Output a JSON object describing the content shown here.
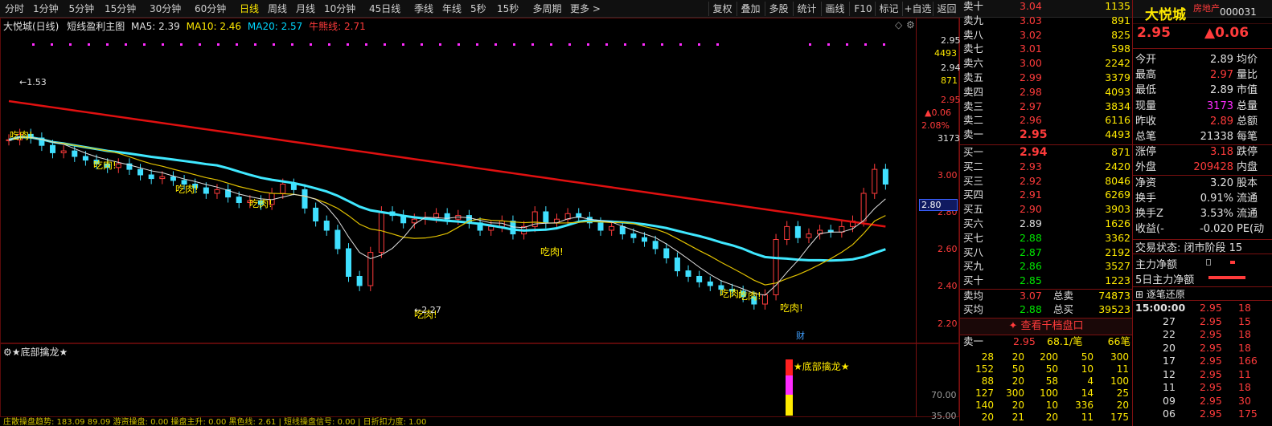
{
  "toolbar": {
    "periods": [
      "分时",
      "1分钟",
      "5分钟",
      "15分钟",
      "30分钟",
      "60分钟",
      "日线",
      "周线",
      "月线",
      "10分钟",
      "45日线",
      "季线",
      "年线",
      "5秒",
      "15秒",
      "多周期",
      "更多 >"
    ],
    "active": "日线",
    "right_buttons": [
      "复权",
      "叠加",
      "多股",
      "统计",
      "画线",
      "F10",
      "标记",
      "+自选",
      "返回"
    ]
  },
  "chart": {
    "title": "大悦城(日线)",
    "indicator": "短线盈利主图",
    "ma5": "MA5: 2.39",
    "ma10": "MA10: 2.46",
    "ma20": "MA20: 2.57",
    "niu": "牛熊线: 2.71",
    "high_label": "1.53",
    "low_label": "2.27",
    "eat": "吃肉!",
    "cai": "财",
    "y_ticks": [
      "3.00",
      "2.80",
      "2.60",
      "2.40",
      "2.20"
    ],
    "right_info": {
      "p1": "2.95",
      "v1": "4493",
      "p2": "2.94",
      "v2": "871",
      "p3": "2.95",
      "chg": "▲0.06",
      "pct": "2.08%",
      "vol": "3173"
    },
    "cur_price": "2.80"
  },
  "sub": {
    "title": "★底部擒龙★",
    "label": "★底部擒龙★",
    "ticks": [
      "70.00",
      "35.00"
    ]
  },
  "bottom_strip": "庄散操盘趋势: 183.09  89.09  游资操盘: 0.00  操盘主升: 0.00  黑色线: 2.61  | 短线操盘信号: 0.00  | 日折扣力度: 1.00",
  "orderbook": {
    "sells": [
      [
        "卖十",
        "3.04",
        "1135"
      ],
      [
        "卖九",
        "3.03",
        "891"
      ],
      [
        "卖八",
        "3.02",
        "825"
      ],
      [
        "卖七",
        "3.01",
        "598"
      ],
      [
        "卖六",
        "3.00",
        "2242"
      ],
      [
        "卖五",
        "2.99",
        "3379"
      ],
      [
        "卖四",
        "2.98",
        "4093"
      ],
      [
        "卖三",
        "2.97",
        "3834"
      ],
      [
        "卖二",
        "2.96",
        "6116"
      ],
      [
        "卖一",
        "2.95",
        "4493"
      ]
    ],
    "buys": [
      [
        "买一",
        "2.94",
        "871"
      ],
      [
        "买二",
        "2.93",
        "2420"
      ],
      [
        "买三",
        "2.92",
        "8046"
      ],
      [
        "买四",
        "2.91",
        "6269"
      ],
      [
        "买五",
        "2.90",
        "3903"
      ],
      [
        "买六",
        "2.89",
        "1626"
      ],
      [
        "买七",
        "2.88",
        "3362"
      ],
      [
        "买八",
        "2.87",
        "2192"
      ],
      [
        "买九",
        "2.86",
        "3527"
      ],
      [
        "买十",
        "2.85",
        "1223"
      ]
    ],
    "avg": [
      [
        "卖均",
        "3.07",
        "总卖",
        "74873"
      ],
      [
        "买均",
        "2.88",
        "总买",
        "39523"
      ]
    ],
    "view": "查看千档盘口",
    "sell1": [
      "卖一",
      "2.95",
      "68.1/笔",
      "66笔"
    ],
    "queue": [
      [
        "28",
        "20",
        "200",
        "50",
        "300"
      ],
      [
        "152",
        "50",
        "50",
        "10",
        "11"
      ],
      [
        "88",
        "20",
        "58",
        "4",
        "100"
      ],
      [
        "127",
        "300",
        "100",
        "14",
        "25"
      ],
      [
        "140",
        "20",
        "10",
        "336",
        "20"
      ],
      [
        "20",
        "21",
        "20",
        "11",
        "175"
      ]
    ]
  },
  "quote": {
    "name": "大悦城",
    "sector": "房地产",
    "code": "000031",
    "price": "2.95",
    "change": "▲0.06",
    "rows": [
      [
        "今开",
        "2.89",
        "均价"
      ],
      [
        "最高",
        "2.97",
        "量比"
      ],
      [
        "最低",
        "2.89",
        "市值"
      ],
      [
        "现量",
        "3173",
        "总量"
      ],
      [
        "昨收",
        "2.89",
        "总额"
      ],
      [
        "总笔",
        "21338",
        "每笔"
      ],
      [
        "涨停",
        "3.18",
        "跌停"
      ],
      [
        "外盘",
        "209428",
        "内盘"
      ],
      [
        "净资",
        "3.20",
        "股本"
      ],
      [
        "换手",
        "0.91%",
        "流通"
      ],
      [
        "换手Z",
        "3.53%",
        "流通"
      ],
      [
        "收益(-",
        "-0.020",
        "PE(动"
      ]
    ],
    "status": "交易状态: 闭市阶段 15",
    "flow1": "主力净额",
    "flow2": "5日主力净额",
    "ticks_title": "逐笔还原",
    "ticks": [
      [
        "15:00:00",
        "2.95",
        "18"
      ],
      [
        "27",
        "2.95",
        "15"
      ],
      [
        "22",
        "2.95",
        "18"
      ],
      [
        "20",
        "2.95",
        "18"
      ],
      [
        "17",
        "2.95",
        "166"
      ],
      [
        "12",
        "2.95",
        "11"
      ],
      [
        "11",
        "2.95",
        "18"
      ],
      [
        "09",
        "2.95",
        "30"
      ],
      [
        "06",
        "2.95",
        "175"
      ]
    ]
  }
}
